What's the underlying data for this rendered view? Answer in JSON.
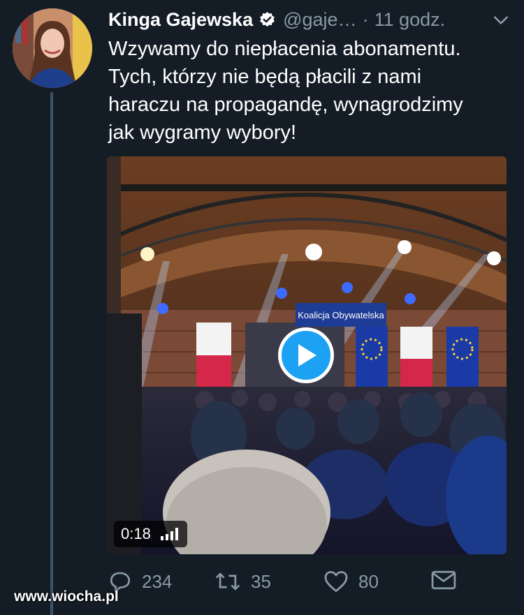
{
  "author": {
    "name": "Kinga Gajewska",
    "handle": "@gaje…",
    "separator": "·",
    "time": "11 godz."
  },
  "tweet": {
    "lines": [
      "Wzywamy do niepłacenia abonamentu.",
      "Tych, którzy nie będą płacili z nami",
      "haraczu na propagandę, wynagrodzimy",
      "jak wygramy wybory!"
    ]
  },
  "video": {
    "duration": "0:18",
    "stage_banner": "Koalicja Obywatelska"
  },
  "actions": {
    "replies": "234",
    "retweets": "35",
    "likes": "80"
  },
  "watermark": "www.wiocha.pl",
  "colors": {
    "background": "#141d26",
    "accent": "#1da1f2",
    "muted": "#8899a6"
  }
}
